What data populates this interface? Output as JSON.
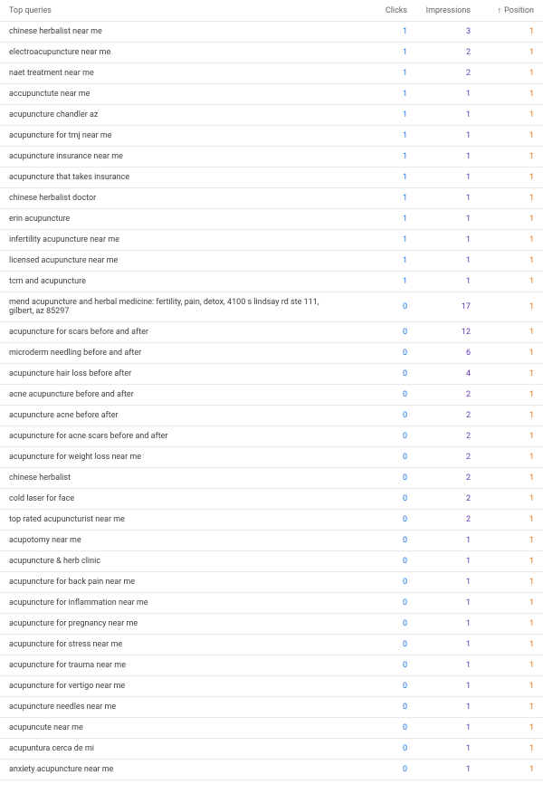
{
  "header": {
    "label": "Top queries",
    "clicks": "Clicks",
    "impressions": "Impressions",
    "position": "Position",
    "sort_icon": "↑"
  },
  "rows": [
    {
      "query": "chinese herbalist near me",
      "clicks": "1",
      "impressions": "3",
      "position": "1"
    },
    {
      "query": "electroacupuncture near me",
      "clicks": "1",
      "impressions": "2",
      "position": "1"
    },
    {
      "query": "naet treatment near me",
      "clicks": "1",
      "impressions": "2",
      "position": "1"
    },
    {
      "query": "accupunctute near me",
      "clicks": "1",
      "impressions": "1",
      "position": "1"
    },
    {
      "query": "acupuncture chandler az",
      "clicks": "1",
      "impressions": "1",
      "position": "1"
    },
    {
      "query": "acupuncture for tmj near me",
      "clicks": "1",
      "impressions": "1",
      "position": "1"
    },
    {
      "query": "acupuncture insurance near me",
      "clicks": "1",
      "impressions": "1",
      "position": "1"
    },
    {
      "query": "acupuncture that takes insurance",
      "clicks": "1",
      "impressions": "1",
      "position": "1"
    },
    {
      "query": "chinese herbalist doctor",
      "clicks": "1",
      "impressions": "1",
      "position": "1"
    },
    {
      "query": "erin acupuncture",
      "clicks": "1",
      "impressions": "1",
      "position": "1"
    },
    {
      "query": "infertility acupuncture near me",
      "clicks": "1",
      "impressions": "1",
      "position": "1"
    },
    {
      "query": "licensed acupuncture near me",
      "clicks": "1",
      "impressions": "1",
      "position": "1"
    },
    {
      "query": "tcm and acupuncture",
      "clicks": "1",
      "impressions": "1",
      "position": "1"
    },
    {
      "query": "mend acupuncture and herbal medicine: fertility, pain, detox, 4100 s lindsay rd ste 111, gilbert, az 85297",
      "clicks": "0",
      "impressions": "17",
      "position": "1"
    },
    {
      "query": "acupuncture for scars before and after",
      "clicks": "0",
      "impressions": "12",
      "position": "1"
    },
    {
      "query": "microderm needling before and after",
      "clicks": "0",
      "impressions": "6",
      "position": "1"
    },
    {
      "query": "acupuncture hair loss before after",
      "clicks": "0",
      "impressions": "4",
      "position": "1"
    },
    {
      "query": "acne acupuncture before and after",
      "clicks": "0",
      "impressions": "2",
      "position": "1"
    },
    {
      "query": "acupuncture acne before after",
      "clicks": "0",
      "impressions": "2",
      "position": "1"
    },
    {
      "query": "acupuncture for acne scars before and after",
      "clicks": "0",
      "impressions": "2",
      "position": "1"
    },
    {
      "query": "acupuncture for weight loss near me",
      "clicks": "0",
      "impressions": "2",
      "position": "1"
    },
    {
      "query": "chinese herbalist",
      "clicks": "0",
      "impressions": "2",
      "position": "1"
    },
    {
      "query": "cold laser for face",
      "clicks": "0",
      "impressions": "2",
      "position": "1"
    },
    {
      "query": "top rated acupuncturist near me",
      "clicks": "0",
      "impressions": "2",
      "position": "1"
    },
    {
      "query": "acupotomy near me",
      "clicks": "0",
      "impressions": "1",
      "position": "1"
    },
    {
      "query": "acupuncture & herb clinic",
      "clicks": "0",
      "impressions": "1",
      "position": "1"
    },
    {
      "query": "acupuncture for back pain near me",
      "clicks": "0",
      "impressions": "1",
      "position": "1"
    },
    {
      "query": "acupuncture for inflammation near me",
      "clicks": "0",
      "impressions": "1",
      "position": "1"
    },
    {
      "query": "acupuncture for pregnancy near me",
      "clicks": "0",
      "impressions": "1",
      "position": "1"
    },
    {
      "query": "acupuncture for stress near me",
      "clicks": "0",
      "impressions": "1",
      "position": "1"
    },
    {
      "query": "acupuncture for trauma near me",
      "clicks": "0",
      "impressions": "1",
      "position": "1"
    },
    {
      "query": "acupuncture for vertigo near me",
      "clicks": "0",
      "impressions": "1",
      "position": "1"
    },
    {
      "query": "acupuncture needles near me",
      "clicks": "0",
      "impressions": "1",
      "position": "1"
    },
    {
      "query": "acupuncute near me",
      "clicks": "0",
      "impressions": "1",
      "position": "1"
    },
    {
      "query": "acupuntura cerca de mi",
      "clicks": "0",
      "impressions": "1",
      "position": "1"
    },
    {
      "query": "anxiety acupuncture near me",
      "clicks": "0",
      "impressions": "1",
      "position": "1"
    }
  ]
}
